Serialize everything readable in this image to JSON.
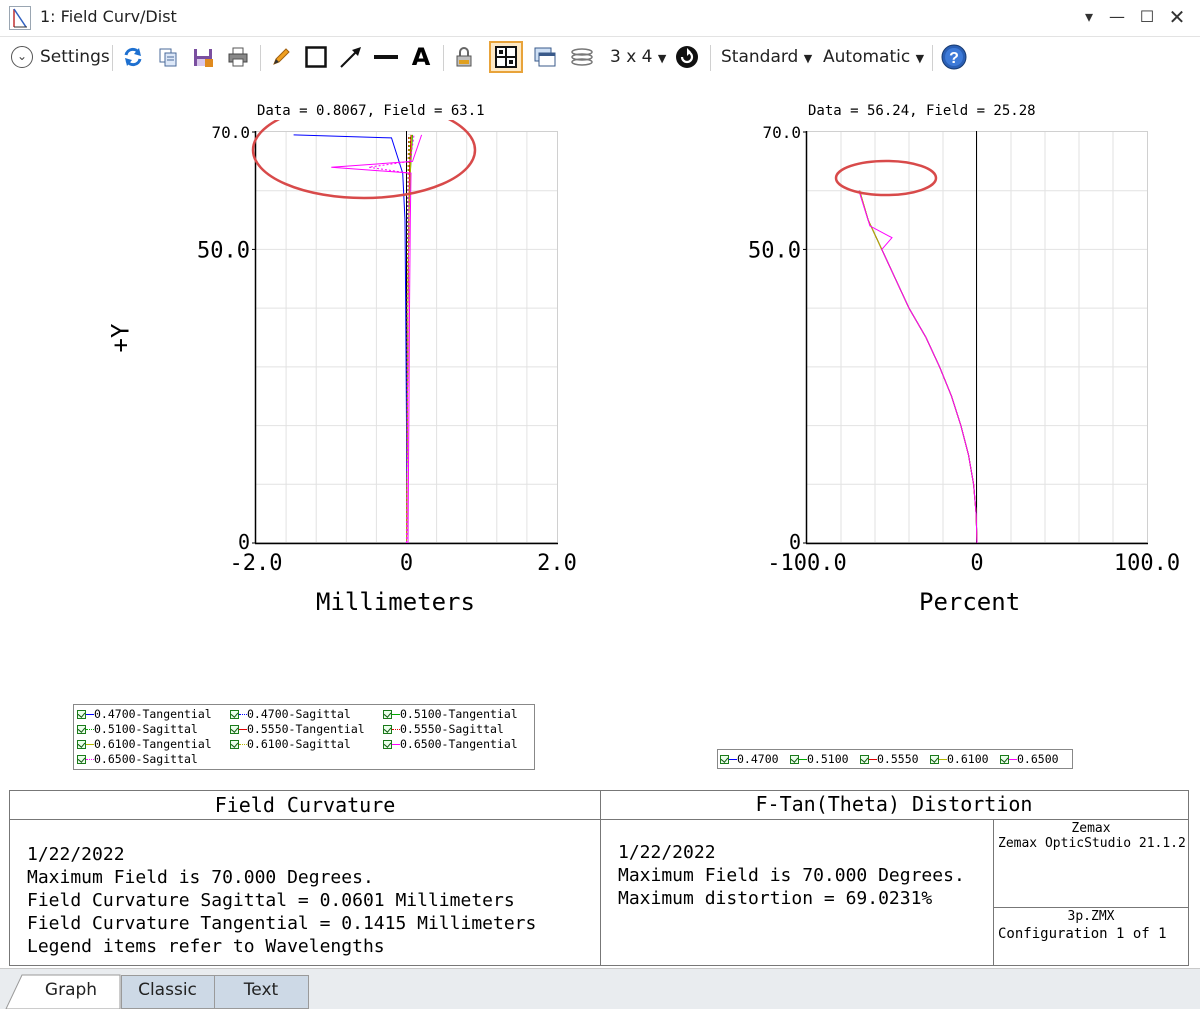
{
  "window": {
    "title": "1: Field Curv/Dist"
  },
  "toolbar": {
    "settings_label": "Settings",
    "layout_label": "3 x 4",
    "standard_label": "Standard",
    "automatic_label": "Automatic",
    "icons": [
      "refresh-icon",
      "copy-icon",
      "save-icon",
      "print-icon",
      "pencil-icon",
      "rectangle-icon",
      "arrow-icon",
      "line-icon",
      "text-icon",
      "lock-icon",
      "grid-icon",
      "window-icon",
      "layers-icon",
      "cycle-icon",
      "help-icon"
    ]
  },
  "left_chart": {
    "readout": "Data = 0.8067, Field = 63.1",
    "xlabel": "Millimeters",
    "ylabel": "+Y",
    "xticks": [
      "-2.0",
      "0",
      "2.0"
    ],
    "yticks": [
      "70.0",
      "50.0",
      "0"
    ]
  },
  "right_chart": {
    "readout": "Data = 56.24, Field = 25.28",
    "xlabel": "Percent",
    "xticks": [
      "-100.0",
      "0",
      "100.0"
    ],
    "yticks": [
      "70.0",
      "50.0",
      "0"
    ]
  },
  "chart_data": [
    {
      "type": "line",
      "title": "Field Curvature",
      "xlabel": "Millimeters",
      "ylabel": "+Y",
      "xlim": [
        -2.0,
        2.0
      ],
      "ylim": [
        0,
        70.0
      ],
      "grid": true,
      "series": [
        {
          "name": "0.4700-Tangential",
          "color": "#0000ff",
          "dash": false,
          "x": [
            0,
            0,
            -0.01,
            -0.02,
            -0.05,
            -0.2,
            -1.5
          ],
          "y": [
            0,
            20,
            40,
            55,
            63,
            69,
            69.5
          ]
        },
        {
          "name": "0.4700-Sagittal",
          "color": "#0000ff",
          "dash": true,
          "x": [
            0,
            0.01,
            0.01,
            0.01,
            0.02,
            0.03
          ],
          "y": [
            0,
            20,
            40,
            55,
            63,
            69.5
          ]
        },
        {
          "name": "0.5100-Tangential",
          "color": "#00aa00",
          "dash": false,
          "x": [
            0,
            0.01,
            0.02,
            0.03,
            0.05,
            0.08
          ],
          "y": [
            0,
            20,
            40,
            55,
            63,
            69.5
          ]
        },
        {
          "name": "0.5100-Sagittal",
          "color": "#00aa00",
          "dash": true,
          "x": [
            0,
            0.01,
            0.01,
            0.02,
            0.03,
            0.05
          ],
          "y": [
            0,
            20,
            40,
            55,
            63,
            69.5
          ]
        },
        {
          "name": "0.5550-Tangential",
          "color": "#e00000",
          "dash": false,
          "x": [
            0,
            0.01,
            0.02,
            0.03,
            0.04,
            0.06
          ],
          "y": [
            0,
            20,
            40,
            55,
            63,
            69.5
          ]
        },
        {
          "name": "0.5550-Sagittal",
          "color": "#e00000",
          "dash": true,
          "x": [
            0,
            0.01,
            0.01,
            0.02,
            0.02,
            0.03
          ],
          "y": [
            0,
            20,
            40,
            55,
            63,
            69.5
          ]
        },
        {
          "name": "0.6100-Tangential",
          "color": "#b5b500",
          "dash": false,
          "x": [
            0,
            0.01,
            0.02,
            0.03,
            0.05,
            0.07
          ],
          "y": [
            0,
            20,
            40,
            55,
            63,
            69.5
          ]
        },
        {
          "name": "0.6100-Sagittal",
          "color": "#b5b500",
          "dash": true,
          "x": [
            0,
            0.01,
            0.01,
            0.02,
            0.02,
            0.04
          ],
          "y": [
            0,
            20,
            40,
            55,
            63,
            69.5
          ]
        },
        {
          "name": "0.6500-Tangential",
          "color": "#ff00ff",
          "dash": false,
          "x": [
            0.02,
            0.03,
            0.04,
            0.05,
            0.06,
            -1.0,
            0.08,
            0.2
          ],
          "y": [
            0,
            20,
            40,
            55,
            63,
            64,
            65,
            69.5
          ]
        },
        {
          "name": "0.6500-Sagittal",
          "color": "#ff00ff",
          "dash": true,
          "x": [
            0,
            0.01,
            0.02,
            0.03,
            0.03,
            -0.5,
            0.05,
            0.1
          ],
          "y": [
            0,
            20,
            40,
            55,
            63,
            64,
            65,
            69.5
          ]
        }
      ],
      "notes": [
        "1/22/2022",
        "Maximum Field is 70.000 Degrees.",
        "Field Curvature Sagittal = 0.0601 Millimeters",
        "Field Curvature Tangential = 0.1415 Millimeters",
        "Legend items refer to Wavelengths"
      ]
    },
    {
      "type": "line",
      "title": "F-Tan(Theta) Distortion",
      "xlabel": "Percent",
      "ylabel": "+Y",
      "xlim": [
        -100.0,
        100.0
      ],
      "ylim": [
        0,
        70.0
      ],
      "grid": true,
      "series": [
        {
          "name": "0.4700",
          "color": "#0000ff",
          "x": [
            0,
            -0.5,
            -2,
            -5,
            -9.5,
            -15,
            -22,
            -30,
            -40,
            -48,
            -56,
            -64,
            -69.3
          ],
          "y": [
            0,
            5,
            10,
            15,
            20,
            25,
            30,
            35,
            40,
            45,
            50,
            55,
            60
          ]
        },
        {
          "name": "0.5100",
          "color": "#00aa00",
          "x": [
            0,
            -0.5,
            -2,
            -5,
            -9.5,
            -15,
            -22,
            -30,
            -40,
            -48,
            -56,
            -64,
            -69.2
          ],
          "y": [
            0,
            5,
            10,
            15,
            20,
            25,
            30,
            35,
            40,
            45,
            50,
            55,
            60
          ]
        },
        {
          "name": "0.5550",
          "color": "#e00000",
          "x": [
            0,
            -0.5,
            -2,
            -5,
            -9.5,
            -15,
            -22,
            -30,
            -40,
            -48,
            -56,
            -64,
            -69.0
          ],
          "y": [
            0,
            5,
            10,
            15,
            20,
            25,
            30,
            35,
            40,
            45,
            50,
            55,
            60
          ]
        },
        {
          "name": "0.6100",
          "color": "#b5b500",
          "x": [
            0,
            -0.5,
            -2,
            -5,
            -9.5,
            -15,
            -22,
            -30,
            -40,
            -48,
            -56,
            -64,
            -69.0
          ],
          "y": [
            0,
            5,
            10,
            15,
            20,
            25,
            30,
            35,
            40,
            45,
            50,
            55,
            60
          ]
        },
        {
          "name": "0.6500",
          "color": "#ff00ff",
          "x": [
            0,
            -0.5,
            -2,
            -5,
            -9.5,
            -15,
            -22,
            -30,
            -40,
            -48,
            -56,
            -50,
            -63,
            -69.5
          ],
          "y": [
            0,
            5,
            10,
            15,
            20,
            25,
            30,
            35,
            40,
            45,
            50,
            52,
            54,
            60
          ]
        }
      ],
      "notes": [
        "1/22/2022",
        "Maximum Field is 70.000 Degrees.",
        "Maximum distortion = 69.0231%"
      ]
    }
  ],
  "info": {
    "left_title": "Field Curvature",
    "left_lines": [
      "1/22/2022",
      "Maximum Field is 70.000 Degrees.",
      "Field Curvature Sagittal = 0.0601 Millimeters",
      "Field Curvature Tangential = 0.1415 Millimeters",
      "Legend items refer to Wavelengths"
    ],
    "right_title": "F-Tan(Theta) Distortion",
    "right_lines": [
      "1/22/2022",
      "Maximum Field is 70.000 Degrees.",
      "Maximum distortion = 69.0231%"
    ],
    "company": "Zemax",
    "product": "Zemax OpticStudio 21.1.2",
    "file": "3p.ZMX",
    "config": "Configuration 1 of 1"
  },
  "tabs": [
    "Graph",
    "Classic",
    "Text"
  ]
}
